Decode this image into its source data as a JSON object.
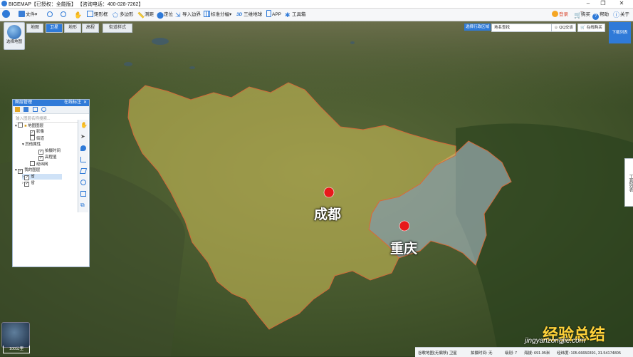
{
  "window": {
    "title": "BIGEMAP【已授权：全能版】 【咨询电话：400-028-7262】"
  },
  "toolbar": {
    "file": "文件",
    "rect": "矩形框",
    "polygon": "多边形",
    "measure": "测距",
    "locate": "定位",
    "import_boundary": "导入边界",
    "grid": "标准分幅",
    "three_d_icon": "3D",
    "three_d": "三维地球",
    "app": "APP",
    "toolbox": "工具箱",
    "vip": "登录",
    "buy": "购买",
    "help": "帮助",
    "about": "关于"
  },
  "map_left": {
    "select_map_label": "选择地图",
    "tabs": [
      "地图",
      "卫星",
      "地形",
      "高程"
    ],
    "active_tab": "卫星",
    "street_style": "街道样式"
  },
  "map_right": {
    "admin_select": "选择行政区域",
    "place_search": "地名查找",
    "qq": "QQ交谈",
    "buy_online": "在线购买",
    "download_list": "下载列表",
    "tool_list": "工具列表"
  },
  "layer_panel": {
    "title": "图层管理",
    "online_tag": "在线标注",
    "search_placeholder": "输入图层名称搜索...",
    "items": [
      {
        "label": "地图图层",
        "checked": false
      },
      {
        "label": "影像",
        "checked": true
      },
      {
        "label": "街道",
        "checked": false
      },
      {
        "label": "其他属性",
        "checked": false
      },
      {
        "label": "拍摄时间",
        "checked": true
      },
      {
        "label": "高程值",
        "checked": true
      },
      {
        "label": "经纬网",
        "checked": false
      },
      {
        "label": "我的图层",
        "checked": true
      },
      {
        "label": "省",
        "checked": true
      },
      {
        "label": "省",
        "checked": true
      }
    ]
  },
  "map_labels": {
    "chengdu": "成都",
    "chongqing": "重庆"
  },
  "scale": "100公里",
  "status": {
    "map_name": "谷歌地图(无偏移) 卫星",
    "shoot_time": "拍摄时间: 无",
    "level": "级别: 7",
    "elevation": "海拔: 691.95米",
    "coords": "经纬度: 105.66650391, 31.54174805"
  },
  "watermark": {
    "brand": "经验总结",
    "url": "jingyanzongjie.com"
  },
  "colors": {
    "accent": "#2f7ad8",
    "sichuan_fill": "#d4c25a",
    "chongqing_fill": "#b7c8d8",
    "boundary": "#d46a3a",
    "city_dot": "#e8191b"
  }
}
